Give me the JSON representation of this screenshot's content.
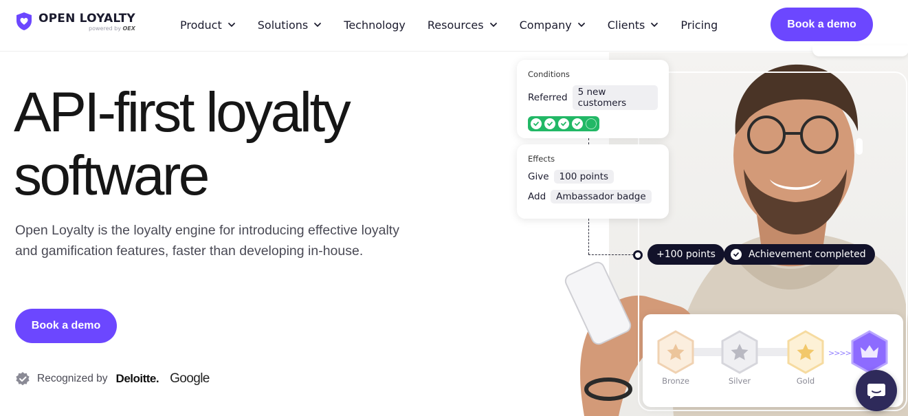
{
  "brand": {
    "name": "OPEN LOYALTY",
    "powered_prefix": "powered by",
    "powered_brand": "OEX",
    "accent": "#6c47ff"
  },
  "nav": {
    "items": [
      {
        "label": "Product",
        "dropdown": true
      },
      {
        "label": "Solutions",
        "dropdown": true
      },
      {
        "label": "Technology",
        "dropdown": false
      },
      {
        "label": "Resources",
        "dropdown": true
      },
      {
        "label": "Company",
        "dropdown": true
      },
      {
        "label": "Clients",
        "dropdown": true
      },
      {
        "label": "Pricing",
        "dropdown": false
      }
    ],
    "cta_label": "Book a demo"
  },
  "hero": {
    "headline_line1": "API-first loyalty",
    "headline_line2": "software",
    "subtitle": "Open Loyalty is the loyalty engine for introducing effective loyalty and gamification features, faster than developing in-house.",
    "cta_label": "Book a demo",
    "recognized_label": "Recognized by",
    "recognized_logos": [
      "Deloitte.",
      "Google"
    ]
  },
  "visual": {
    "conditions": {
      "title": "Conditions",
      "key": "Referred",
      "value": "5 new customers",
      "progress_done": 4,
      "progress_total": 5
    },
    "effects": {
      "title": "Effects",
      "rows": [
        {
          "key": "Give",
          "value": "100 points"
        },
        {
          "key": "Add",
          "value": "Ambassador badge"
        }
      ]
    },
    "points_pill": "+100 points",
    "achievement_pill": "Achievement completed",
    "tiers": [
      {
        "name": "Bronze",
        "color": "#e8b27a"
      },
      {
        "name": "Silver",
        "color": "#a9a9b2"
      },
      {
        "name": "Gold",
        "color": "#f0c15a"
      },
      {
        "name": "",
        "color": "#7a5cff"
      }
    ],
    "tier_arrows": ">>>>>"
  }
}
